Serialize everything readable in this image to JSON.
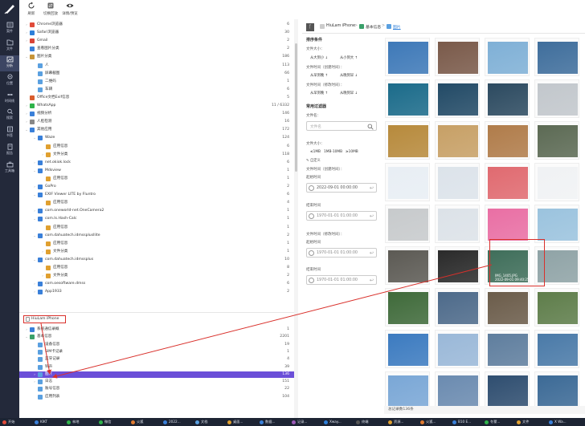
{
  "nav": [
    {
      "label": "案件",
      "icon": "case-icon"
    },
    {
      "label": "文件",
      "icon": "file-icon"
    },
    {
      "label": "分析",
      "icon": "analysis-icon",
      "active": true
    },
    {
      "label": "位置",
      "icon": "location-icon"
    },
    {
      "label": "时间线",
      "icon": "timeline-icon"
    },
    {
      "label": "搜索",
      "icon": "search-icon"
    },
    {
      "label": "书签",
      "icon": "bookmark-icon"
    },
    {
      "label": "报告",
      "icon": "report-icon"
    },
    {
      "label": "工具箱",
      "icon": "toolbox-icon"
    }
  ],
  "toolbar": [
    {
      "label": "刷新",
      "icon": "refresh-icon"
    },
    {
      "label": "切换回放",
      "icon": "switch-icon"
    },
    {
      "label": "详情/预览",
      "icon": "eye-icon"
    }
  ],
  "tree": [
    {
      "label": "Chrome浏览器",
      "count": "6",
      "indent": 1,
      "toggle": ">",
      "color": "#e04b3a"
    },
    {
      "label": "Safari浏览器",
      "count": "30",
      "indent": 1,
      "toggle": ">",
      "color": "#2d7fd9"
    },
    {
      "label": "Gmail",
      "count": "2",
      "indent": 1,
      "toggle": ">",
      "color": "#d94437"
    },
    {
      "label": "查看图片分类",
      "count": "2",
      "indent": 1,
      "toggle": "",
      "color": "#3a80d9"
    },
    {
      "label": "图片分类",
      "count": "186",
      "indent": 1,
      "toggle": "v",
      "color": "#c79438"
    },
    {
      "label": "人",
      "count": "113",
      "indent": 2,
      "toggle": "",
      "color": "#5aa0e0"
    },
    {
      "label": "屏幕截图",
      "count": "66",
      "indent": 2,
      "toggle": "",
      "color": "#5aa0e0"
    },
    {
      "label": "二维码",
      "count": "1",
      "indent": 2,
      "toggle": "",
      "color": "#5aa0e0"
    },
    {
      "label": "车辆",
      "count": "6",
      "indent": 2,
      "toggle": "",
      "color": "#5aa0e0"
    },
    {
      "label": "Office文档Exif信息",
      "count": "5",
      "indent": 1,
      "toggle": "",
      "color": "#d95d2e"
    },
    {
      "label": "WhatsApp",
      "count": "11 / 6332",
      "indent": 1,
      "toggle": ">",
      "color": "#2fb34a"
    },
    {
      "label": "视频分析",
      "count": "146",
      "indent": 1,
      "toggle": ">",
      "color": "#3a80d9"
    },
    {
      "label": "人脸检测",
      "count": "16",
      "indent": 1,
      "toggle": ">",
      "color": "#888888"
    },
    {
      "label": "其他应用",
      "count": "172",
      "indent": 1,
      "toggle": "v",
      "color": "#3a80d9"
    },
    {
      "label": "Waze",
      "count": "124",
      "indent": 2,
      "toggle": "v",
      "color": "#3a80d9"
    },
    {
      "label": "应用信息",
      "count": "6",
      "indent": 3,
      "toggle": "",
      "color": "#e0a030"
    },
    {
      "label": "文件分类",
      "count": "118",
      "indent": 3,
      "toggle": ">",
      "color": "#e0a030"
    },
    {
      "label": "net.okiok.lock",
      "count": "6",
      "indent": 2,
      "toggle": ">",
      "color": "#3a80d9"
    },
    {
      "label": "Mdsview",
      "count": "1",
      "indent": 2,
      "toggle": "v",
      "color": "#3a80d9"
    },
    {
      "label": "应用信息",
      "count": "1",
      "indent": 3,
      "toggle": "",
      "color": "#e0a030"
    },
    {
      "label": "GoPro",
      "count": "2",
      "indent": 2,
      "toggle": ">",
      "color": "#3a80d9"
    },
    {
      "label": "EXIF Viewer LITE by Fluntro",
      "count": "6",
      "indent": 2,
      "toggle": "v",
      "color": "#3a80d9"
    },
    {
      "label": "应用信息",
      "count": "4",
      "indent": 3,
      "toggle": "",
      "color": "#e0a030"
    },
    {
      "label": "com.oneworld-net.OneCamera2",
      "count": "1",
      "indent": 2,
      "toggle": ">",
      "color": "#3a80d9"
    },
    {
      "label": "com.Is.Hash-Calc",
      "count": "1",
      "indent": 2,
      "toggle": "v",
      "color": "#3a80d9"
    },
    {
      "label": "应用信息",
      "count": "1",
      "indent": 3,
      "toggle": "",
      "color": "#e0a030"
    },
    {
      "label": "com.dahuatech.idmssplusllite",
      "count": "2",
      "indent": 2,
      "toggle": "v",
      "color": "#3a80d9"
    },
    {
      "label": "应用信息",
      "count": "1",
      "indent": 3,
      "toggle": "",
      "color": "#e0a030"
    },
    {
      "label": "文件分类",
      "count": "1",
      "indent": 3,
      "toggle": ">",
      "color": "#e0a030"
    },
    {
      "label": "com.dahuatech.idmssplus",
      "count": "10",
      "indent": 2,
      "toggle": "v",
      "color": "#3a80d9"
    },
    {
      "label": "应用信息",
      "count": "8",
      "indent": 3,
      "toggle": "",
      "color": "#e0a030"
    },
    {
      "label": "文件分类",
      "count": "2",
      "indent": 3,
      "toggle": ">",
      "color": "#e0a030"
    },
    {
      "label": "com.oesoftware.dmss",
      "count": "6",
      "indent": 2,
      "toggle": ">",
      "color": "#3a80d9"
    },
    {
      "label": "App1933",
      "count": "2",
      "indent": 2,
      "toggle": ">",
      "color": "#3a80d9"
    }
  ],
  "device": {
    "label": "HiuLam iPhone"
  },
  "device_tree": [
    {
      "label": "系统通信录概",
      "count": "1",
      "indent": 1,
      "toggle": ">",
      "color": "#3a80d9"
    },
    {
      "label": "基本信息",
      "count": "2201",
      "indent": 1,
      "toggle": "v",
      "color": "#3aa06a"
    },
    {
      "label": "设备信息",
      "count": "19",
      "indent": 2,
      "toggle": "",
      "color": "#5aa0e0"
    },
    {
      "label": "SIM卡记录",
      "count": "1",
      "indent": 2,
      "toggle": "",
      "color": "#5aa0e0"
    },
    {
      "label": "蓝牙记录",
      "count": "4",
      "indent": 2,
      "toggle": "",
      "color": "#5aa0e0"
    },
    {
      "label": "铃声",
      "count": "39",
      "indent": 2,
      "toggle": "",
      "color": "#5aa0e0"
    },
    {
      "label": "图片",
      "count": "136",
      "indent": 2,
      "toggle": ">",
      "color": "#5aa0e0",
      "selected": true
    },
    {
      "label": "日志",
      "count": "151",
      "indent": 2,
      "toggle": ">",
      "color": "#5aa0e0"
    },
    {
      "label": "账号信息",
      "count": "22",
      "indent": 2,
      "toggle": "",
      "color": "#5aa0e0"
    },
    {
      "label": "应用列表",
      "count": "104",
      "indent": 2,
      "toggle": "",
      "color": "#5aa0e0"
    }
  ],
  "breadcrumb": {
    "device": "HiuLam iPhone",
    "section": "基本信息",
    "current": "图片"
  },
  "filter": {
    "sort_title": "排序条件",
    "file_size": "文件大小：",
    "size_asc": "从大到小 ↓",
    "size_desc": "从小到大 ↑",
    "create_time": "文件时间（创建时间）：",
    "create_new": "从早到晚 ↑",
    "create_old": "从晚到早 ↓",
    "modify_time": "文件时间（修改时间）：",
    "modify_new": "从早到晚 ↑",
    "modify_old": "从晚到早 ↓",
    "common_title": "常用过滤器",
    "filename_label": "文件名：",
    "filename_placeholder": "文件名",
    "size_label": "文件大小：",
    "size_opts": [
      "≤1MB",
      "1MB-10MB",
      "≥10MB"
    ],
    "custom": "自定义",
    "ctime_label": "文件时间（创建时间）：",
    "start_label": "起始时间",
    "ctime_start": "2022-09-01 00:00:00",
    "end_label": "结束时间",
    "ctime_end": "1970-01-01 01:00:00",
    "mtime_label": "文件时间（修改时间）：",
    "mstart_label": "起始时间",
    "mtime_start": "1970-01-01 01:00:00",
    "mend_label": "结束时间",
    "mtime_end": "1970-01-01 01:00:00"
  },
  "highlight": {
    "filename": "IMG_1405.JPG",
    "date": "2022-09-01 09:40:25"
  },
  "status": "总记录数136条",
  "taskbar": [
    "开始",
    "KIKT",
    "林地",
    "微信",
    "火狐",
    "2022...",
    "文档",
    "桌面...",
    "数据...",
    "记录...",
    "Xway...",
    "终端",
    "资源...",
    "火狐...",
    "B10 E...",
    "冬蒙...",
    "文件",
    "X Wa..."
  ],
  "photo_colors": [
    [
      "#3e79b8",
      "#7a5a4a",
      "#7fb0d6",
      "#3f6e9c"
    ],
    [
      "#1b6b8a",
      "#224a66",
      "#2c4a60",
      "#c2c7cc"
    ],
    [
      "#b78a3c",
      "#c7a066",
      "#b07c4a",
      "#5c6a54"
    ],
    [
      "#e8eef4",
      "#dce3ea",
      "#e06a70",
      "#f0f2f4"
    ],
    [
      "#c7cacc",
      "#dce2e8",
      "#e96fa4",
      "#9bc3de"
    ],
    [
      "#5c5a54",
      "#2a2a2a",
      "#3f6e5a",
      "#8fa3a6"
    ],
    [
      "#3f6a3a",
      "#4d6a8a",
      "#6b5c4a",
      "#5e7d4a"
    ],
    [
      "#3c7bc0",
      "#9ab8d8",
      "#5f7e9e",
      "#4a7aa8"
    ],
    [
      "#7aa7d6",
      "#6b8bb0",
      "#2f4e70",
      "#3c6a96"
    ]
  ]
}
